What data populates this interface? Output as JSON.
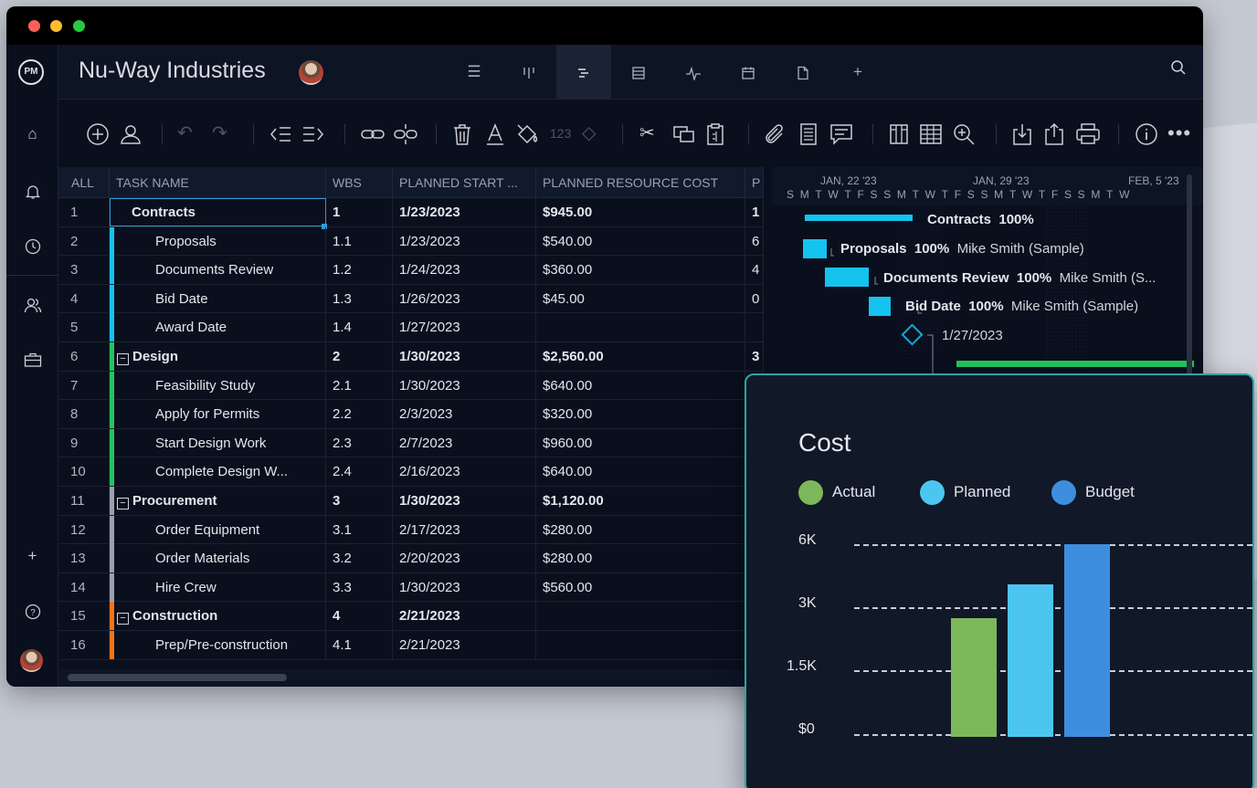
{
  "app": {
    "project_title": "Nu-Way Industries",
    "logo_text": "PM"
  },
  "colors": {
    "accent": "#16c2ee",
    "window_bg": "#0a0f1e",
    "card_border": "#2aa5a8",
    "actual": "#7cb85a",
    "planned": "#4cc6f0",
    "budget": "#3e8ee0"
  },
  "view_tabs": [
    "list-icon",
    "board-icon",
    "gantt-icon",
    "sheet-icon",
    "dashboard-icon",
    "calendar-icon",
    "files-icon",
    "add-icon"
  ],
  "active_view": "gantt-icon",
  "grid": {
    "headers": {
      "all": "ALL",
      "task_name": "TASK NAME",
      "wbs": "WBS",
      "planned_start": "PLANNED START ...",
      "planned_cost": "PLANNED RESOURCE COST",
      "p": "P"
    },
    "rows": [
      {
        "n": "1",
        "name": "Contracts",
        "wbs": "1",
        "start": "1/23/2023",
        "cost": "$945.00",
        "p": "1",
        "bold": true
      },
      {
        "n": "2",
        "name": "Proposals",
        "wbs": "1.1",
        "start": "1/23/2023",
        "cost": "$540.00",
        "p": "6"
      },
      {
        "n": "3",
        "name": "Documents Review",
        "wbs": "1.2",
        "start": "1/24/2023",
        "cost": "$360.00",
        "p": "4"
      },
      {
        "n": "4",
        "name": "Bid Date",
        "wbs": "1.3",
        "start": "1/26/2023",
        "cost": "$45.00",
        "p": "0"
      },
      {
        "n": "5",
        "name": "Award Date",
        "wbs": "1.4",
        "start": "1/27/2023",
        "cost": "",
        "p": ""
      },
      {
        "n": "6",
        "name": "Design",
        "wbs": "2",
        "start": "1/30/2023",
        "cost": "$2,560.00",
        "p": "3",
        "bold": true
      },
      {
        "n": "7",
        "name": "Feasibility Study",
        "wbs": "2.1",
        "start": "1/30/2023",
        "cost": "$640.00",
        "p": ""
      },
      {
        "n": "8",
        "name": "Apply for Permits",
        "wbs": "2.2",
        "start": "2/3/2023",
        "cost": "$320.00",
        "p": ""
      },
      {
        "n": "9",
        "name": "Start Design Work",
        "wbs": "2.3",
        "start": "2/7/2023",
        "cost": "$960.00",
        "p": ""
      },
      {
        "n": "10",
        "name": "Complete Design W...",
        "wbs": "2.4",
        "start": "2/16/2023",
        "cost": "$640.00",
        "p": ""
      },
      {
        "n": "11",
        "name": "Procurement",
        "wbs": "3",
        "start": "1/30/2023",
        "cost": "$1,120.00",
        "p": "",
        "bold": true
      },
      {
        "n": "12",
        "name": "Order Equipment",
        "wbs": "3.1",
        "start": "2/17/2023",
        "cost": "$280.00",
        "p": ""
      },
      {
        "n": "13",
        "name": "Order Materials",
        "wbs": "3.2",
        "start": "2/20/2023",
        "cost": "$280.00",
        "p": ""
      },
      {
        "n": "14",
        "name": "Hire Crew",
        "wbs": "3.3",
        "start": "1/30/2023",
        "cost": "$560.00",
        "p": ""
      },
      {
        "n": "15",
        "name": "Construction",
        "wbs": "4",
        "start": "2/21/2023",
        "cost": "",
        "p": "",
        "bold": true
      },
      {
        "n": "16",
        "name": "Prep/Pre-construction",
        "wbs": "4.1",
        "start": "2/21/2023",
        "cost": "",
        "p": ""
      }
    ]
  },
  "gantt": {
    "weeks": [
      "JAN, 22 '23",
      "JAN, 29 '23",
      "FEB, 5 '23"
    ],
    "days": "SMTWTFSSMTWTFSSMTWTFSSMTW",
    "labels": [
      {
        "task": "Contracts",
        "pct": "100%",
        "res": ""
      },
      {
        "task": "Proposals",
        "pct": "100%",
        "res": "Mike Smith (Sample)"
      },
      {
        "task": "Documents Review",
        "pct": "100%",
        "res": "Mike Smith (S..."
      },
      {
        "task": "Bid Date",
        "pct": "100%",
        "res": "Mike Smith (Sample)"
      },
      {
        "task": "",
        "pct": "",
        "res": "1/27/2023"
      }
    ]
  },
  "cost_card": {
    "title": "Cost",
    "legend": [
      {
        "label": "Actual",
        "color": "#7cb85a"
      },
      {
        "label": "Planned",
        "color": "#4cc6f0"
      },
      {
        "label": "Budget",
        "color": "#3e8ee0"
      }
    ],
    "y_ticks": [
      "6K",
      "3K",
      "1.5K",
      "$0"
    ]
  },
  "chart_data": {
    "type": "bar",
    "title": "Cost",
    "categories": [
      "Actual",
      "Planned",
      "Budget"
    ],
    "values": [
      3700,
      4750,
      6000
    ],
    "y_ticks": [
      "$0",
      "1.5K",
      "3K",
      "6K"
    ],
    "legend": "top",
    "grid": true
  }
}
